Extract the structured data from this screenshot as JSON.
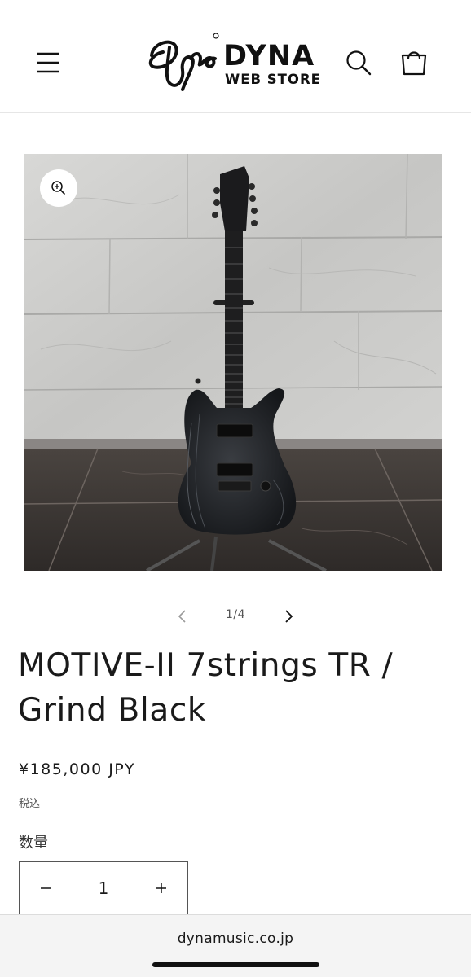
{
  "header": {
    "logo_script": "Dyna",
    "logo_title": "DYNA",
    "logo_subtitle": "WEB STORE",
    "menu_icon": "hamburger-menu-icon",
    "search_icon": "search-icon",
    "cart_icon": "cart-icon"
  },
  "gallery": {
    "zoom_icon": "zoom-in-icon",
    "counter": "1/4",
    "prev_icon": "chevron-left-icon",
    "next_icon": "chevron-right-icon",
    "current_index": 1,
    "total": 4
  },
  "product": {
    "title": "MOTIVE-II 7strings TR / Grind Black",
    "price": "¥185,000 JPY",
    "tax_note": "税込",
    "quantity_label": "数量",
    "quantity_value": "1",
    "minus_icon": "minus-icon",
    "plus_icon": "plus-icon"
  },
  "browser": {
    "url": "dynamusic.co.jp"
  }
}
